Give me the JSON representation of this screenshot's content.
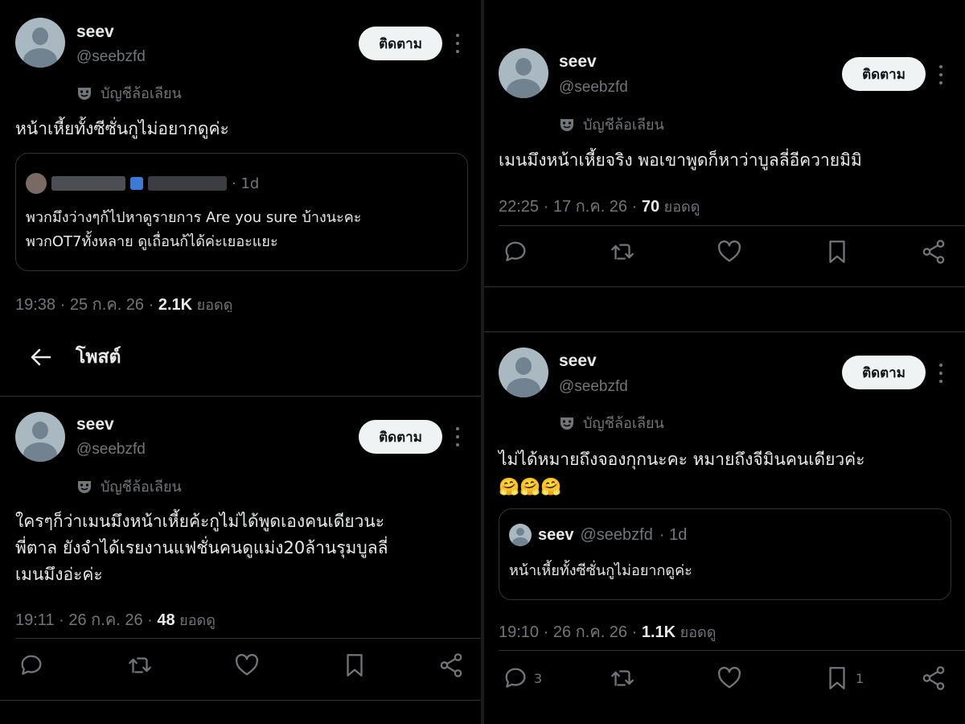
{
  "author": {
    "name": "seev",
    "handle": "@seebzfd",
    "follow_label": "ติดตาม",
    "parody_label": "บัญชีล้อเลียน"
  },
  "header": {
    "title": "โพสต์"
  },
  "posts": [
    {
      "text": "หน้าเหี้ยทั้งซีซั่นกูไม่อยากดูค่ะ",
      "quote": {
        "time": "· 1d",
        "text": "พวกมึงว่างๆก้ไปหาดูรายการ Are you sure บ้างนะคะ\nพวกOT7ทั้งหลาย ดูเถื่อนก้ได้ค่ะเยอะแยะ"
      },
      "meta": {
        "time": "19:38",
        "date": "25 ก.ค. 26",
        "views": "2.1K",
        "views_label": "ยอดดู"
      }
    },
    {
      "text": "ใครๆก็ว่าเมนมึงหน้าเหี้ยค้ะกูไม่ได้พูดเองคนเดียวนะ\nพี่ตาล ยังจำได้เรยงานแฟชั่นคนดูแม่ง20ล้านรุมบูลลี่\nเมนมึงอ่ะค่ะ",
      "meta": {
        "time": "19:11",
        "date": "26 ก.ค. 26",
        "views": "48",
        "views_label": "ยอดดู"
      }
    },
    {
      "text": "เมนมึงหน้าเหี้ยจริง พอเขาพูดก็หาว่าบูลลี่อีควายมิมิ",
      "meta": {
        "time": "22:25",
        "date": "17 ก.ค. 26",
        "views": "70",
        "views_label": "ยอดดู"
      }
    },
    {
      "text": "ไม่ได้หมายถึงจองกุกนะคะ หมายถึงจีมินคนเดียวค่ะ\n🤗🤗🤗",
      "quote": {
        "name": "seev",
        "handle": "@seebzfd",
        "time": "· 1d",
        "text": "หน้าเหี้ยทั้งซีซั่นกูไม่อยากดูค่ะ"
      },
      "meta": {
        "time": "19:10",
        "date": "26 ก.ค. 26",
        "views": "1.1K",
        "views_label": "ยอดดู"
      },
      "counts": {
        "reply": "3",
        "bookmark": "1"
      }
    }
  ],
  "icons": [
    "back-arrow-icon",
    "parody-mask-icon",
    "more-icon",
    "reply-icon",
    "retweet-icon",
    "like-icon",
    "bookmark-icon",
    "share-icon"
  ],
  "colors": {
    "background": "#000000",
    "text": "#e7e9ea",
    "muted": "#71767b",
    "border": "#2f3336",
    "button": "#eff3f4"
  }
}
